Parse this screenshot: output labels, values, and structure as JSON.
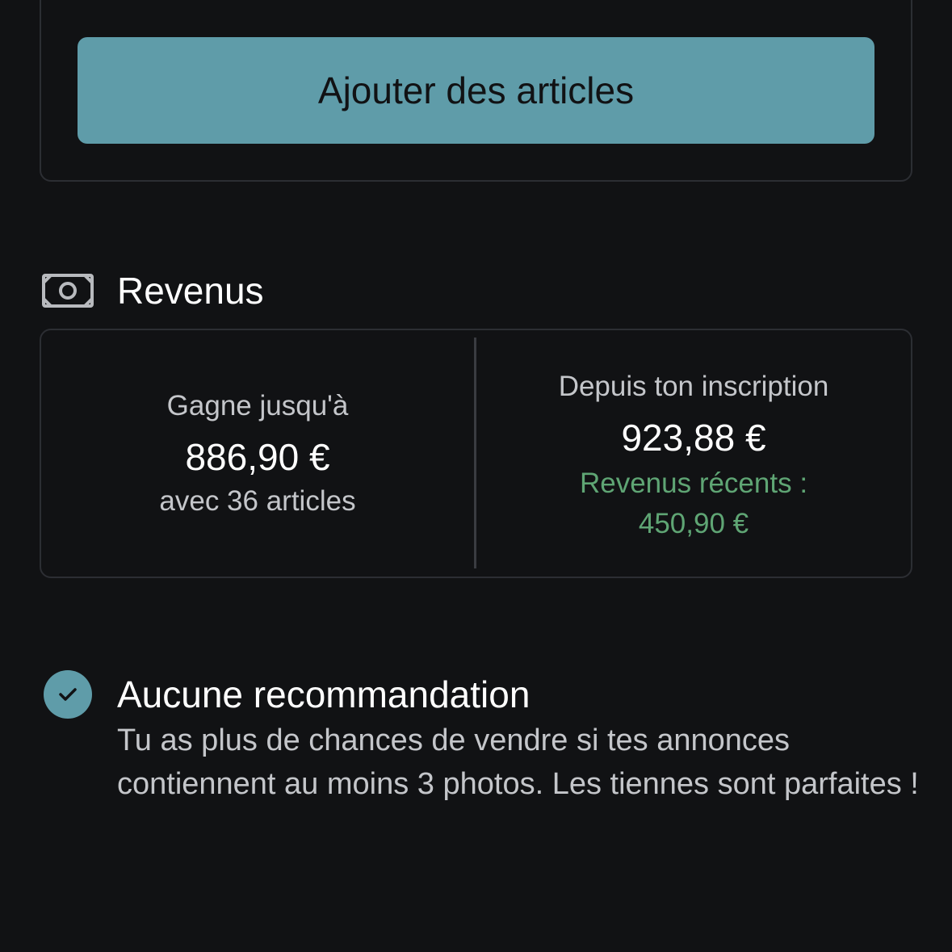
{
  "top": {
    "add_button_label": "Ajouter des articles"
  },
  "revenus": {
    "icon": "money-icon",
    "title": "Revenus",
    "left": {
      "label": "Gagne jusqu'à",
      "amount": "886,90 €",
      "sub": "avec 36 articles"
    },
    "right": {
      "label": "Depuis ton inscription",
      "amount": "923,88 €",
      "recent_label": "Revenus récents :",
      "recent_amount": "450,90 €"
    }
  },
  "recommendation": {
    "icon": "check-circle-icon",
    "title": "Aucune recommandation",
    "text": "Tu as plus de chances de vendre si tes annonces contiennent au moins 3 photos. Les tiennes sont parfaites !"
  },
  "colors": {
    "background": "#111214",
    "accent": "#5f9ca9",
    "positive": "#5fa574",
    "border": "#2c2e33"
  }
}
